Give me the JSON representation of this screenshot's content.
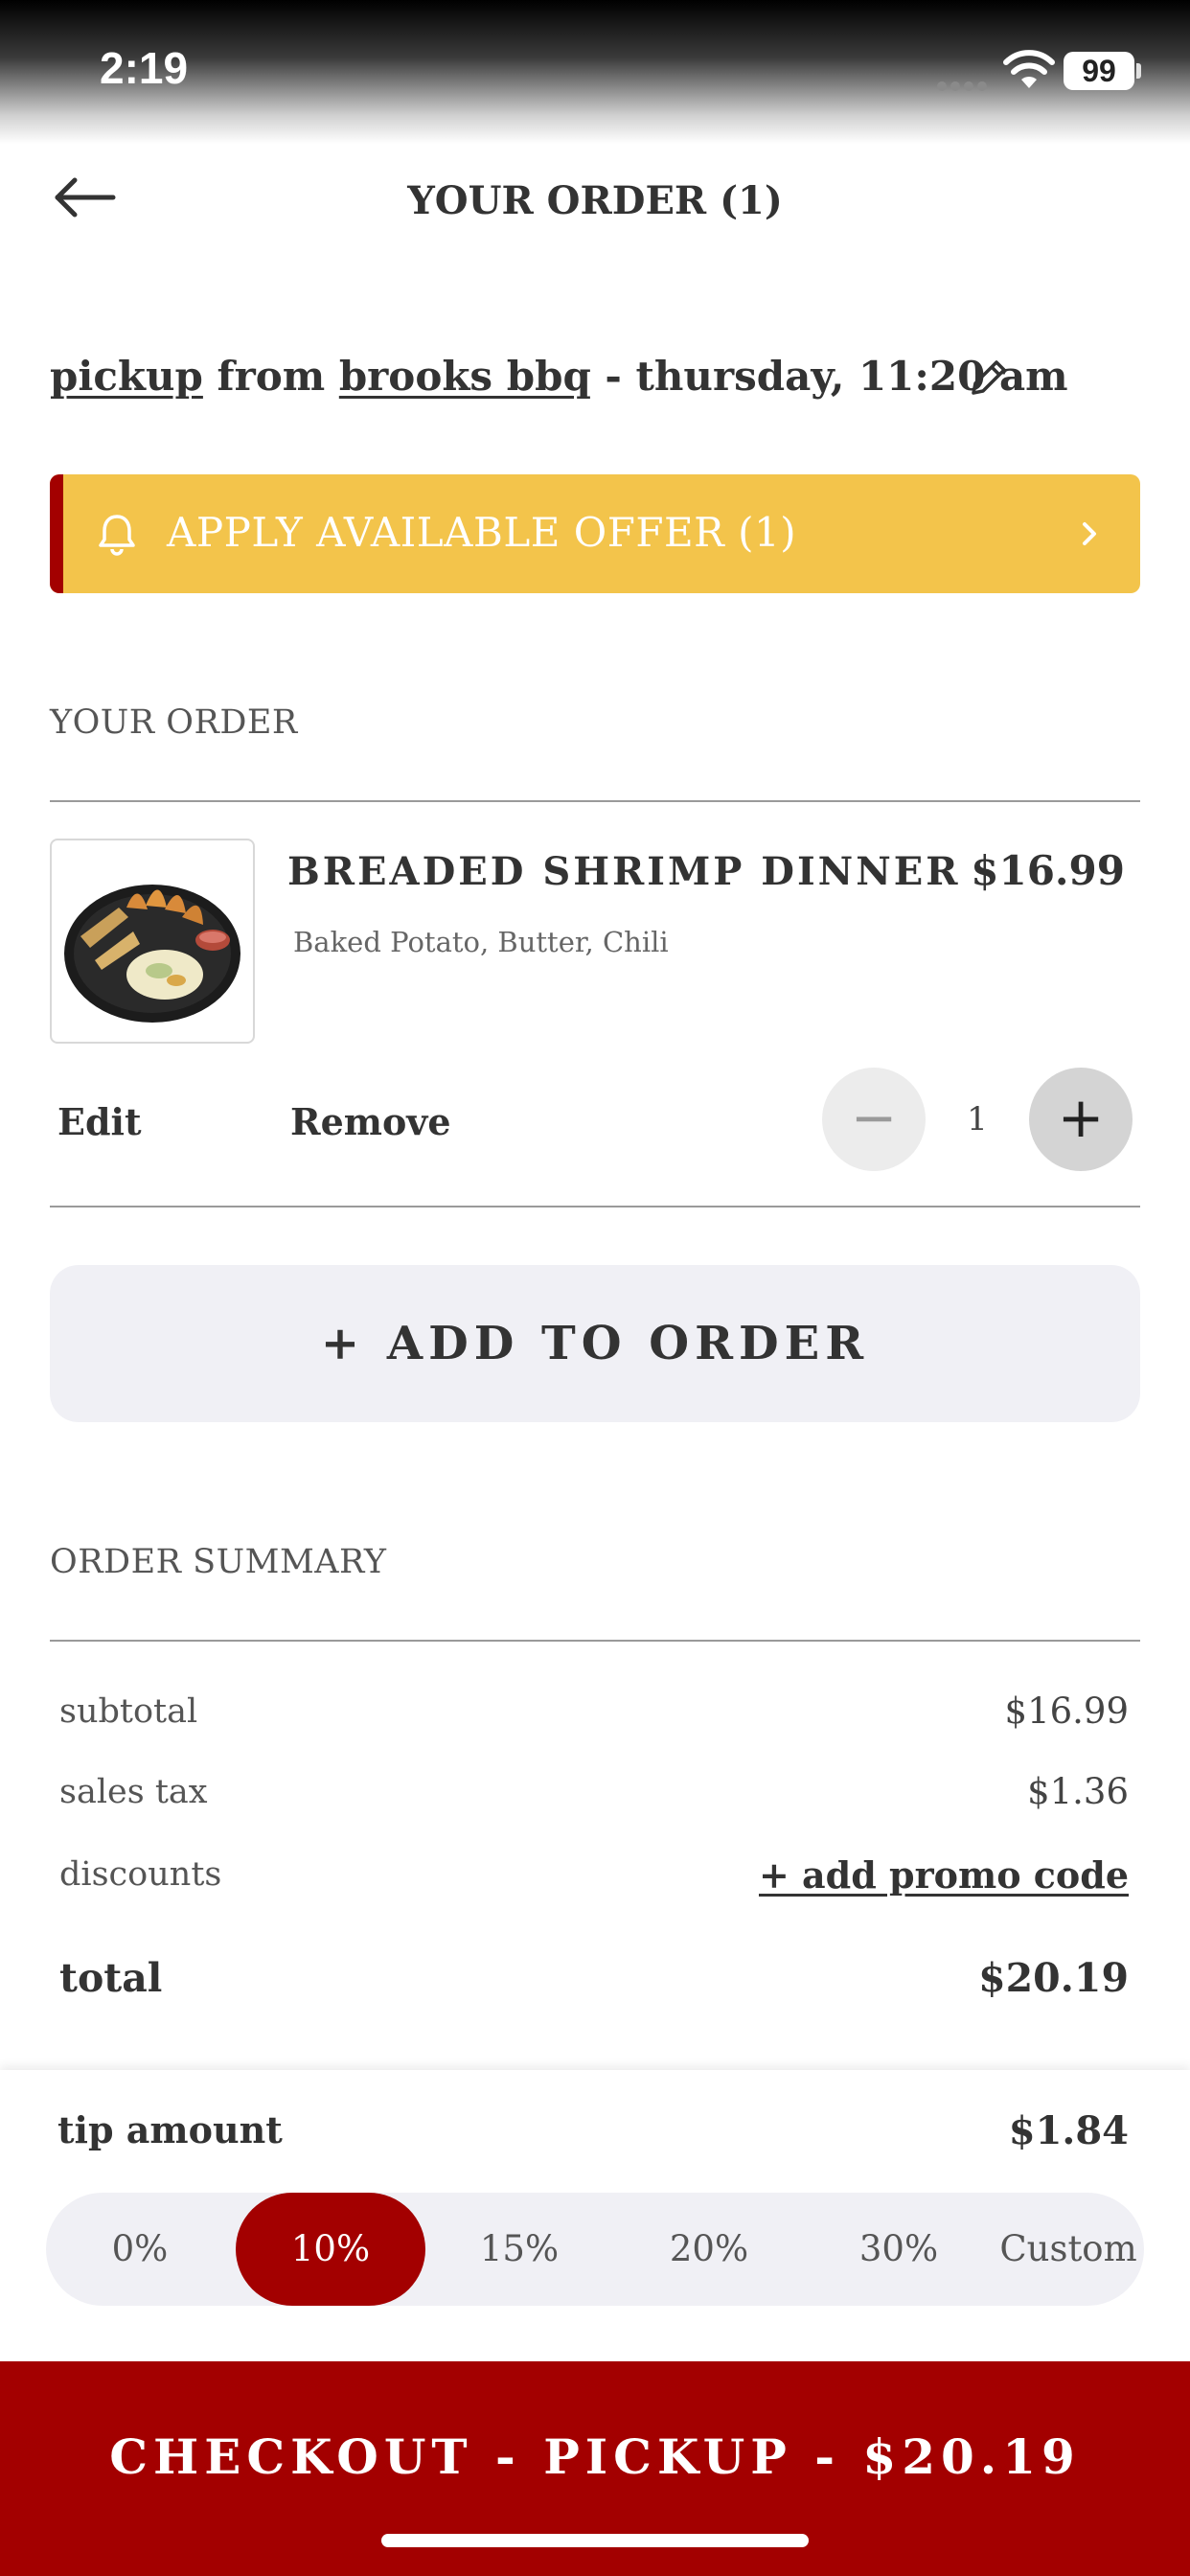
{
  "status_bar": {
    "time": "2:19",
    "battery": "99"
  },
  "header": {
    "title": "YOUR ORDER (1)"
  },
  "pickup": {
    "mode": "pickup",
    "from": "from",
    "location": "brooks bbq",
    "time": " - thursday, 11:20 am"
  },
  "offer": {
    "label": "APPLY AVAILABLE OFFER (1)",
    "accent": "#f3c44b",
    "stripe": "#a30000"
  },
  "your_order": {
    "heading": "YOUR ORDER",
    "items": [
      {
        "name": "BREADED SHRIMP DINNER",
        "price": "$16.99",
        "modifiers": "Baked Potato, Butter, Chili",
        "edit_label": "Edit",
        "remove_label": "Remove",
        "quantity": "1",
        "minus_label": "−",
        "plus_label": "+"
      }
    ],
    "add_label": "+ ADD TO ORDER"
  },
  "summary": {
    "heading": "ORDER SUMMARY",
    "subtotal_label": "subtotal",
    "subtotal_value": "$16.99",
    "tax_label": "sales tax",
    "tax_value": "$1.36",
    "discounts_label": "discounts",
    "promo_label": "+ add promo code",
    "total_label": "total",
    "total_value": "$20.19"
  },
  "tip": {
    "label": "tip amount",
    "value": "$1.84",
    "options": [
      "0%",
      "10%",
      "15%",
      "20%",
      "30%",
      "Custom"
    ],
    "selected": "10%"
  },
  "checkout": {
    "label": "CHECKOUT - PICKUP - $20.19",
    "color": "#a30000"
  }
}
